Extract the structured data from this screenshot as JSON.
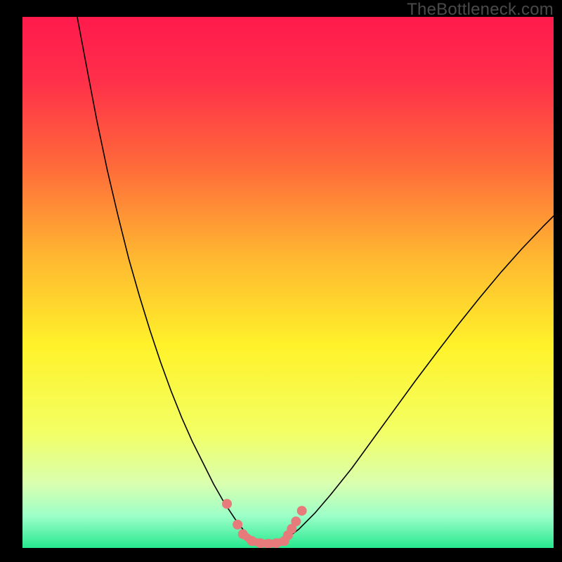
{
  "watermark": "TheBottleneck.com",
  "chart_data": {
    "type": "line",
    "title": "",
    "xlabel": "",
    "ylabel": "",
    "xlim": [
      0,
      100
    ],
    "ylim": [
      0,
      100
    ],
    "gradient_stops": [
      {
        "offset": 0.0,
        "color": "#ff1a4c"
      },
      {
        "offset": 0.12,
        "color": "#ff2f4a"
      },
      {
        "offset": 0.28,
        "color": "#ff6a3a"
      },
      {
        "offset": 0.45,
        "color": "#ffb631"
      },
      {
        "offset": 0.62,
        "color": "#fff22a"
      },
      {
        "offset": 0.78,
        "color": "#f3ff63"
      },
      {
        "offset": 0.88,
        "color": "#d9ffb0"
      },
      {
        "offset": 0.94,
        "color": "#9cffc8"
      },
      {
        "offset": 1.0,
        "color": "#27e88f"
      }
    ],
    "series": [
      {
        "name": "left-curve",
        "type": "line",
        "color": "#000000",
        "width": 1.6,
        "x": [
          10.3,
          12,
          14,
          16,
          18,
          20,
          22,
          24,
          26,
          28,
          30,
          32,
          34,
          36,
          38,
          40,
          41.5,
          43
        ],
        "y": [
          100,
          91,
          80.5,
          71,
          62.5,
          54.5,
          47.5,
          41,
          35,
          29.5,
          24.5,
          20,
          16,
          12,
          8.5,
          5.5,
          3.5,
          2
        ]
      },
      {
        "name": "right-curve",
        "type": "line",
        "color": "#000000",
        "width": 1.6,
        "x": [
          50,
          52,
          55,
          58,
          62,
          66,
          70,
          74,
          78,
          82,
          86,
          90,
          94,
          98,
          100
        ],
        "y": [
          2,
          3.5,
          6.5,
          10,
          15,
          20.5,
          26,
          31.5,
          36.8,
          42,
          47,
          51.8,
          56.3,
          60.5,
          62.5
        ]
      },
      {
        "name": "valley-dots",
        "type": "scatter",
        "color": "#e77a7a",
        "radius_px": 7,
        "x": [
          38.5,
          40.5,
          41.5,
          43.2,
          44.8,
          46.3,
          47.8,
          49.3,
          50.0,
          50.7,
          51.5,
          52.6
        ],
        "y": [
          8.3,
          4.4,
          2.6,
          1.3,
          0.9,
          0.8,
          0.9,
          1.3,
          2.4,
          3.6,
          5.0,
          7.0
        ]
      },
      {
        "name": "valley-line",
        "type": "line",
        "color": "#e77a7a",
        "width": 11,
        "x": [
          41.5,
          43.2,
          44.8,
          46.3,
          47.8,
          49.3,
          50.0
        ],
        "y": [
          2.6,
          1.3,
          0.9,
          0.8,
          0.9,
          1.3,
          2.4
        ]
      }
    ]
  }
}
